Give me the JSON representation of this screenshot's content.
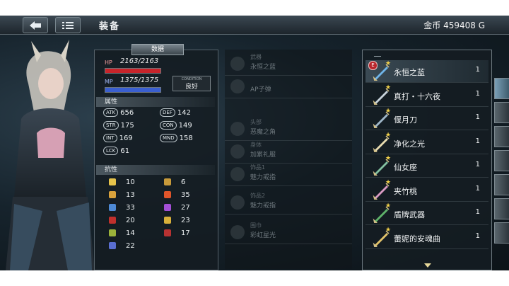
{
  "header": {
    "title": "装备",
    "gold_label": "金币 459408 G"
  },
  "stats": {
    "panel_title": "数据",
    "hp_label": "HP",
    "hp_value": "2163/2163",
    "hp_fraction": 1.0,
    "mp_label": "MP",
    "mp_value": "1375/1375",
    "mp_fraction": 1.0,
    "condition_label": "CONDITION",
    "condition_value": "良好",
    "attributes_title": "属性",
    "attributes": [
      {
        "abbr": "ATK",
        "value": "656"
      },
      {
        "abbr": "DEF",
        "value": "142"
      },
      {
        "abbr": "STR",
        "value": "175"
      },
      {
        "abbr": "CON",
        "value": "149"
      },
      {
        "abbr": "INT",
        "value": "169"
      },
      {
        "abbr": "MND",
        "value": "158"
      },
      {
        "abbr": "LCK",
        "value": "61"
      }
    ],
    "resist_title": "抗性",
    "resistances": [
      {
        "icon": "crescent-icon",
        "color": "#e6c34a",
        "value": "10"
      },
      {
        "icon": "feather-icon",
        "color": "#c89a3a",
        "value": "6"
      },
      {
        "icon": "fist-icon",
        "color": "#d9a23c",
        "value": "13"
      },
      {
        "icon": "fire-icon",
        "color": "#e0552a",
        "value": "35"
      },
      {
        "icon": "ice-icon",
        "color": "#4e8ad6",
        "value": "33"
      },
      {
        "icon": "lightning-icon",
        "color": "#a34fd6",
        "value": "27"
      },
      {
        "icon": "poison-icon",
        "color": "#c0302c",
        "value": "20"
      },
      {
        "icon": "light-icon",
        "color": "#d8b03a",
        "value": "23"
      },
      {
        "icon": "earth-icon",
        "color": "#9bb23a",
        "value": "14"
      },
      {
        "icon": "dark-icon",
        "color": "#b83232",
        "value": "17"
      },
      {
        "icon": "curse-icon",
        "color": "#5a6ed0",
        "value": "22"
      }
    ]
  },
  "slots": [
    {
      "category": "武器",
      "item": "永恒之蓝"
    },
    {
      "category": "",
      "item": "AP子弹"
    },
    {
      "category": "头部",
      "item": "恶魔之角"
    },
    {
      "category": "身体",
      "item": "加累礼服"
    },
    {
      "category": "饰品1",
      "item": "魅力戒指"
    },
    {
      "category": "饰品2",
      "item": "魅力戒指"
    },
    {
      "category": "围巾",
      "item": "彩虹星光"
    }
  ],
  "inventory": {
    "items": [
      {
        "name": "永恒之蓝",
        "qty": "1",
        "equipped_badge": "E",
        "icon": "sword-blue-icon",
        "color": "#6fb4e8"
      },
      {
        "name": "真打・十六夜",
        "qty": "1",
        "equipped_badge": "",
        "icon": "katana-icon",
        "color": "#c6d2da"
      },
      {
        "name": "偃月刀",
        "qty": "1",
        "equipped_badge": "",
        "icon": "glaive-icon",
        "color": "#9fb7c9"
      },
      {
        "name": "净化之光",
        "qty": "1",
        "equipped_badge": "",
        "icon": "light-sword-icon",
        "color": "#e8dcb0"
      },
      {
        "name": "仙女座",
        "qty": "1",
        "equipped_badge": "",
        "icon": "andromeda-icon",
        "color": "#82c0a0"
      },
      {
        "name": "夹竹桃",
        "qty": "1",
        "equipped_badge": "",
        "icon": "whip-icon",
        "color": "#d99ac2"
      },
      {
        "name": "盾牌武器",
        "qty": "1",
        "equipped_badge": "",
        "icon": "shield-weapon-icon",
        "color": "#5fb36a"
      },
      {
        "name": "蕾妮的安魂曲",
        "qty": "1",
        "equipped_badge": "",
        "icon": "spear-icon",
        "color": "#e2c36a"
      }
    ]
  }
}
